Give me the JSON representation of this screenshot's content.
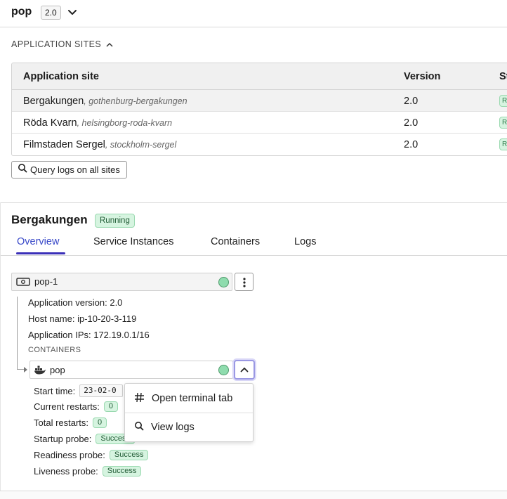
{
  "header": {
    "app_name": "pop",
    "version": "2.0"
  },
  "sites_section": {
    "label": "APPLICATION SITES",
    "columns": [
      "Application site",
      "Version",
      "St"
    ],
    "rows": [
      {
        "name": "Bergakungen",
        "slug": ", gothenburg-bergakungen",
        "version": "2.0",
        "status_initial": "R",
        "selected": true
      },
      {
        "name": "Röda Kvarn",
        "slug": ", helsingborg-roda-kvarn",
        "version": "2.0",
        "status_initial": "R",
        "selected": false
      },
      {
        "name": "Filmstaden Sergel",
        "slug": ", stockholm-sergel",
        "version": "2.0",
        "status_initial": "R",
        "selected": false
      }
    ],
    "query_button": "Query logs on all sites"
  },
  "site_detail": {
    "title": "Bergakungen",
    "status": "Running",
    "tabs": [
      "Overview",
      "Service Instances",
      "Containers",
      "Logs"
    ],
    "active_tab": "Overview"
  },
  "instance": {
    "name": "pop-1",
    "status_color": "#8fdcae",
    "app_version": "Application version: 2.0",
    "host_name": "Host name: ip-10-20-3-119",
    "app_ips": "Application IPs: 172.19.0.1/16",
    "containers_label": "CONTAINERS"
  },
  "container": {
    "name": "pop",
    "start_time_label": "Start time:",
    "start_time_value": "23-02-0",
    "current_restarts_label": "Current restarts:",
    "current_restarts": "0",
    "total_restarts_label": "Total restarts:",
    "total_restarts": "0",
    "startup_probe_label": "Startup probe:",
    "startup_probe": "Success",
    "readiness_probe_label": "Readiness probe:",
    "readiness_probe": "Success",
    "liveness_probe_label": "Liveness probe:",
    "liveness_probe": "Success"
  },
  "menu": {
    "items": [
      "Open terminal tab",
      "View logs"
    ]
  },
  "colors": {
    "accent": "#3848c8",
    "success_bg": "#d6f4e0",
    "success_border": "#9ad9b0"
  }
}
